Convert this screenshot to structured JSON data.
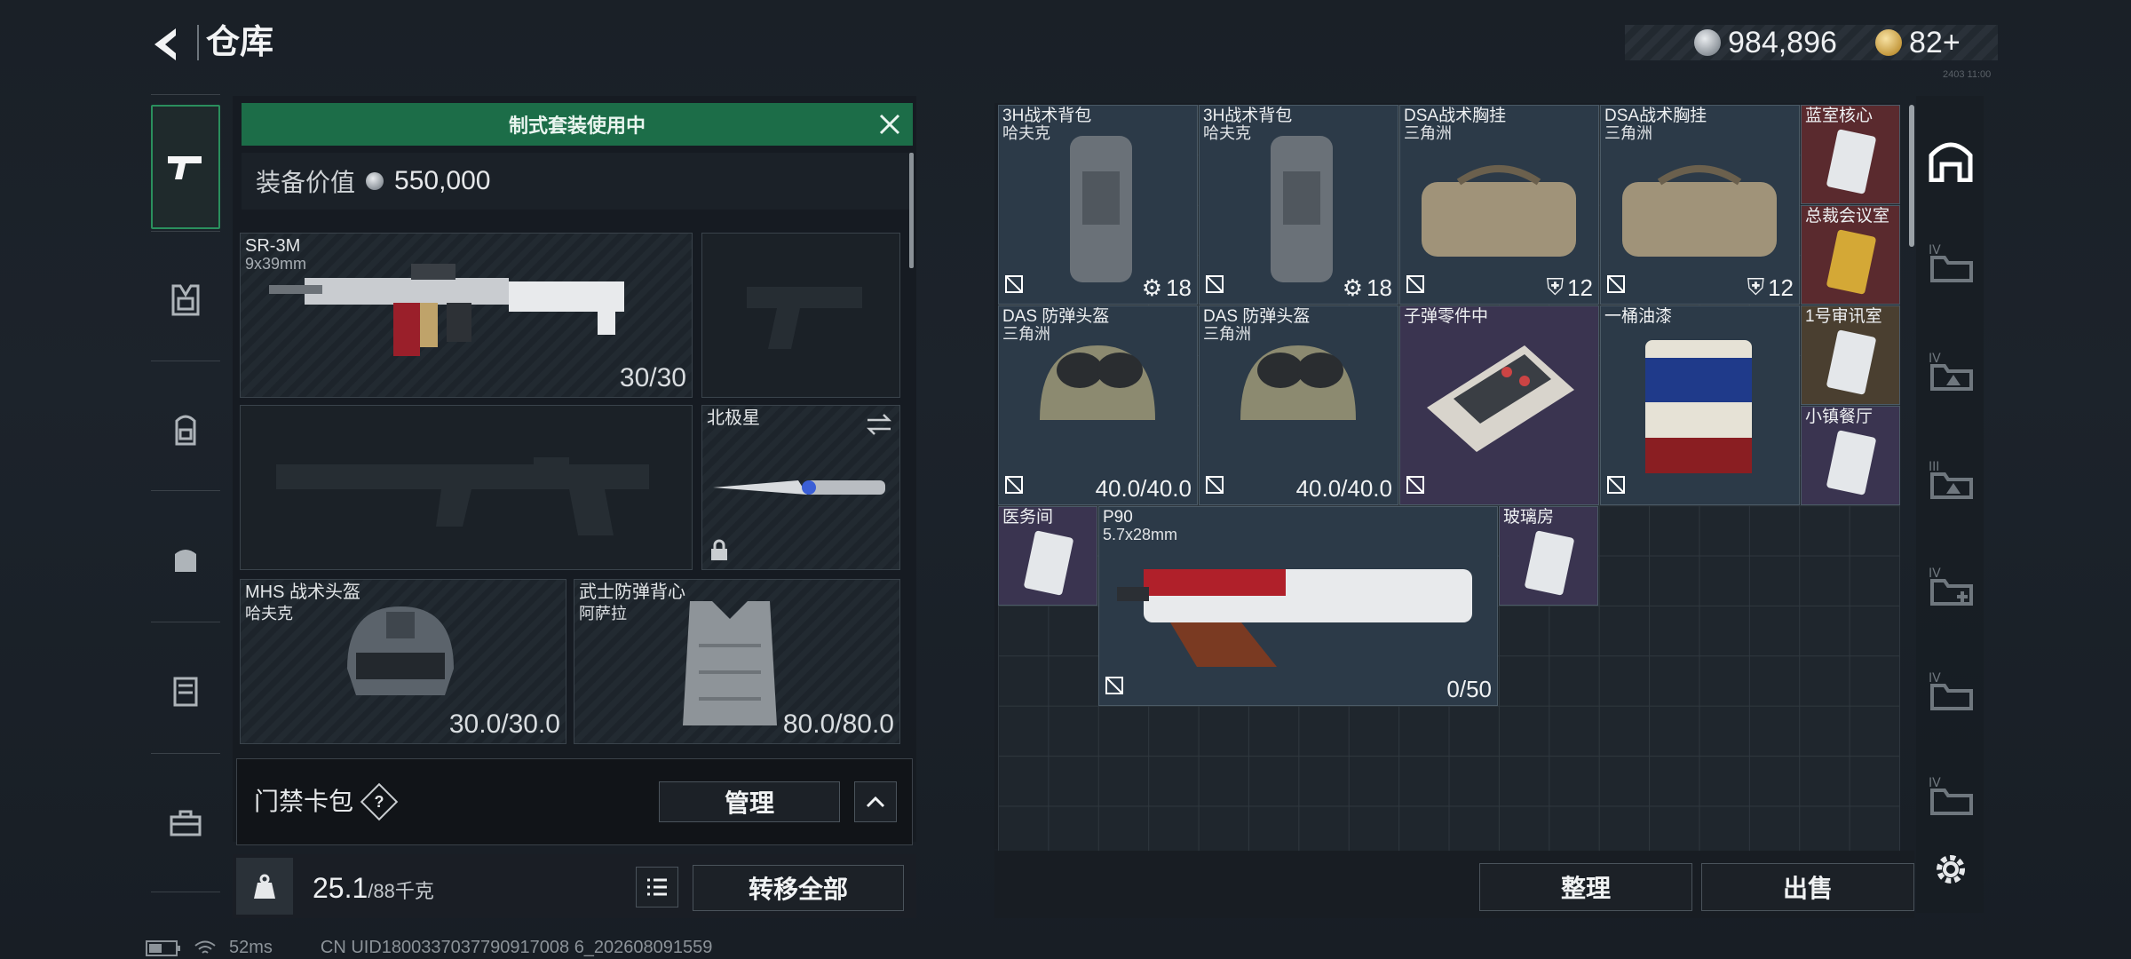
{
  "header": {
    "title": "仓库",
    "currency_silver": "984,896",
    "currency_gold": "82+",
    "version": "2403 11:00"
  },
  "equip": {
    "banner": "制式套装使用中",
    "value_label": "装备价值",
    "value": "550,000",
    "primary_weapon": {
      "name": "SR-3M",
      "caliber": "9x39mm",
      "ammo": "30/30"
    },
    "melee": {
      "name": "北极星"
    },
    "helmet": {
      "name": "MHS 战术头盔",
      "brand": "哈夫克",
      "durability": "30.0/30.0"
    },
    "armor": {
      "name": "武士防弹背心",
      "brand": "阿萨拉",
      "durability": "80.0/80.0"
    },
    "access_label": "门禁卡包",
    "help": "?",
    "manage": "管理",
    "weight": "25.1",
    "weight_max": "/88千克",
    "transfer_all": "转移全部"
  },
  "status": {
    "ping": "52ms",
    "uid": "CN UID1800337037790917008 6_202608091559"
  },
  "stash": {
    "items": [
      {
        "name": "3H战术背包",
        "brand": "哈夫克",
        "count": "18"
      },
      {
        "name": "3H战术背包",
        "brand": "哈夫克",
        "count": "18"
      },
      {
        "name": "DSA战术胸挂",
        "brand": "三角洲",
        "count": "12"
      },
      {
        "name": "DSA战术胸挂",
        "brand": "三角洲",
        "count": "12"
      },
      {
        "name": "蓝室核心"
      },
      {
        "name": "总裁会议室"
      },
      {
        "name": "DAS 防弹头盔",
        "brand": "三角洲",
        "durability": "40.0/40.0"
      },
      {
        "name": "DAS 防弹头盔",
        "brand": "三角洲",
        "durability": "40.0/40.0"
      },
      {
        "name": "子弹零件中"
      },
      {
        "name": "一桶油漆"
      },
      {
        "name": "1号审讯室"
      },
      {
        "name": "小镇餐厅"
      },
      {
        "name": "医务间"
      },
      {
        "name": "P90",
        "caliber": "5.7x28mm",
        "ammo": "0/50"
      },
      {
        "name": "玻璃房"
      }
    ],
    "sort": "整理",
    "sell": "出售"
  },
  "colors": {
    "accent_green": "#1c6d48",
    "cell_blue": "#2c3a48",
    "cell_red": "#5a2a2e"
  }
}
